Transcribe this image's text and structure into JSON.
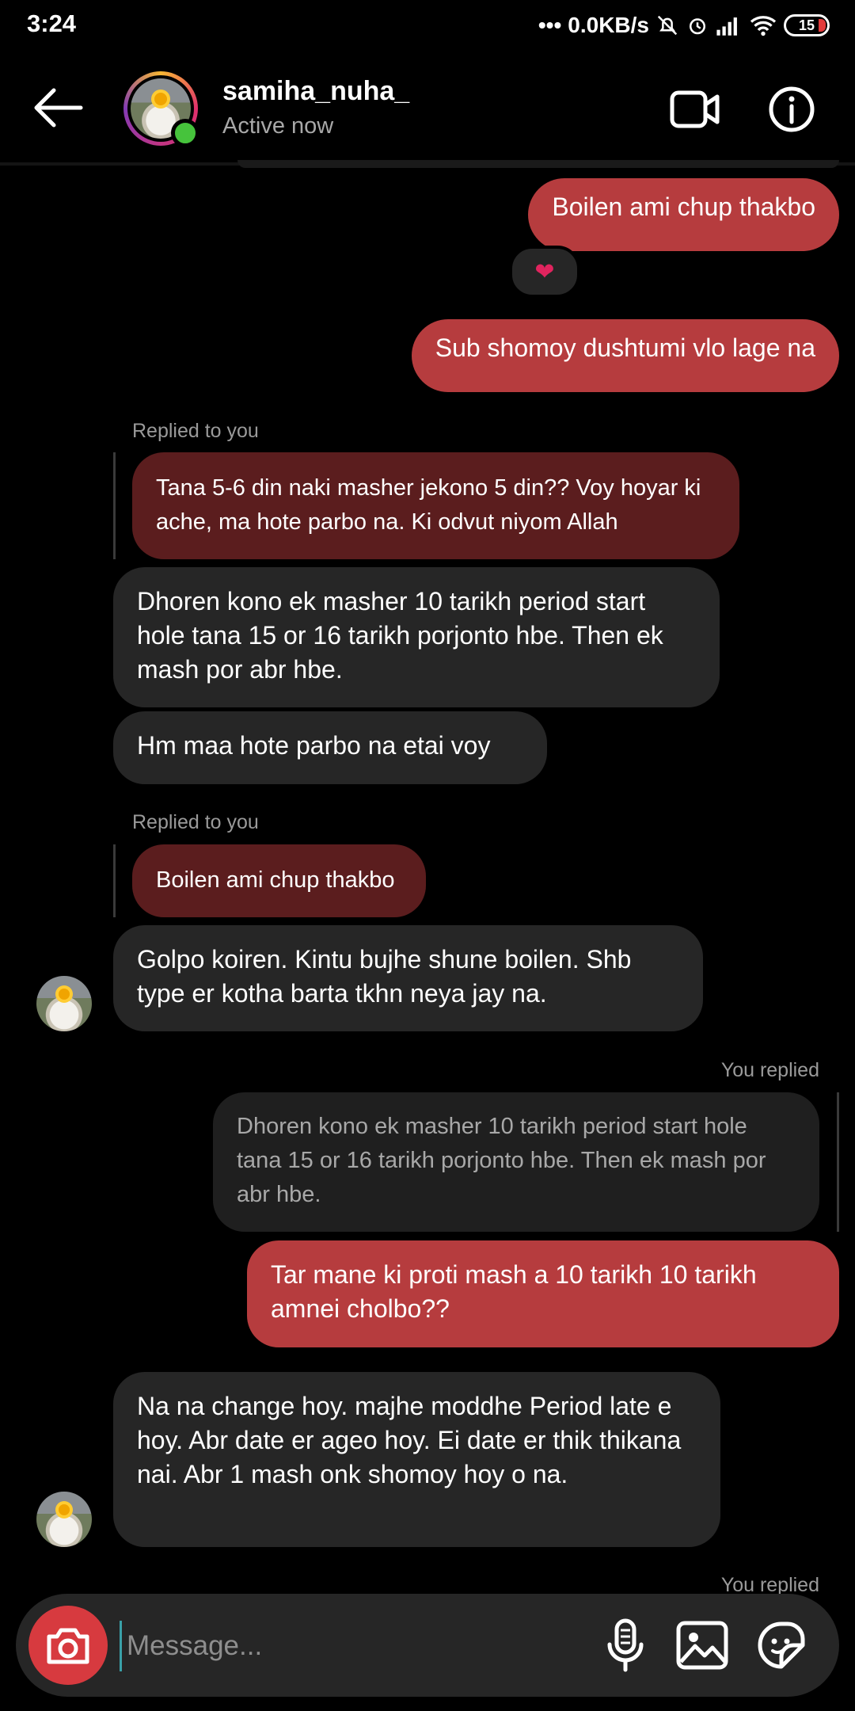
{
  "status_bar": {
    "time": "3:24",
    "network_speed": "0.0KB/s",
    "battery": "15"
  },
  "header": {
    "username": "samiha_nuha_",
    "status": "Active now"
  },
  "messages": {
    "m1": "Boilen ami chup thakbo",
    "m1_reaction": "❤",
    "m2": "Sub shomoy dushtumi vlo lage na",
    "r1_label": "Replied to you",
    "r1_quote": "Tana 5-6 din naki masher jekono 5 din?? Voy hoyar ki ache, ma hote parbo na. Ki odvut niyom Allah",
    "m3": "Dhoren kono ek masher 10 tarikh period start hole tana 15 or 16 tarikh porjonto hbe. Then ek mash por abr hbe.",
    "m4": "Hm maa hote parbo na etai voy",
    "r2_label": "Replied to you",
    "r2_quote": "Boilen ami chup thakbo",
    "m5": "Golpo koiren. Kintu bujhe shune boilen. Shb type er kotha barta tkhn neya jay na.",
    "r3_label": "You replied",
    "r3_quote": "Dhoren kono ek masher 10 tarikh period start hole tana 15 or 16 tarikh porjonto hbe. Then ek mash por abr hbe.",
    "m6": "Tar mane ki proti mash a 10 tarikh 10 tarikh amnei cholbo??",
    "m7": "Na na change hoy. majhe moddhe Period late e hoy. Abr date er ageo hoy. Ei date er thik thikana nai. Abr 1 mash onk shomoy hoy o na.",
    "r4_label": "You replied"
  },
  "composer": {
    "placeholder": "Message..."
  },
  "icons": {
    "back": "arrow-left-icon",
    "video": "video-camera-icon",
    "info": "info-icon",
    "camera": "camera-icon",
    "mic": "microphone-icon",
    "gallery": "image-icon",
    "sticker": "sticker-icon"
  },
  "colors": {
    "outgoing_bubble": "#b63c3e",
    "incoming_bubble": "#262626",
    "quoted_outgoing": "#5b1d1e",
    "online": "#46c33c",
    "background": "#000000"
  }
}
